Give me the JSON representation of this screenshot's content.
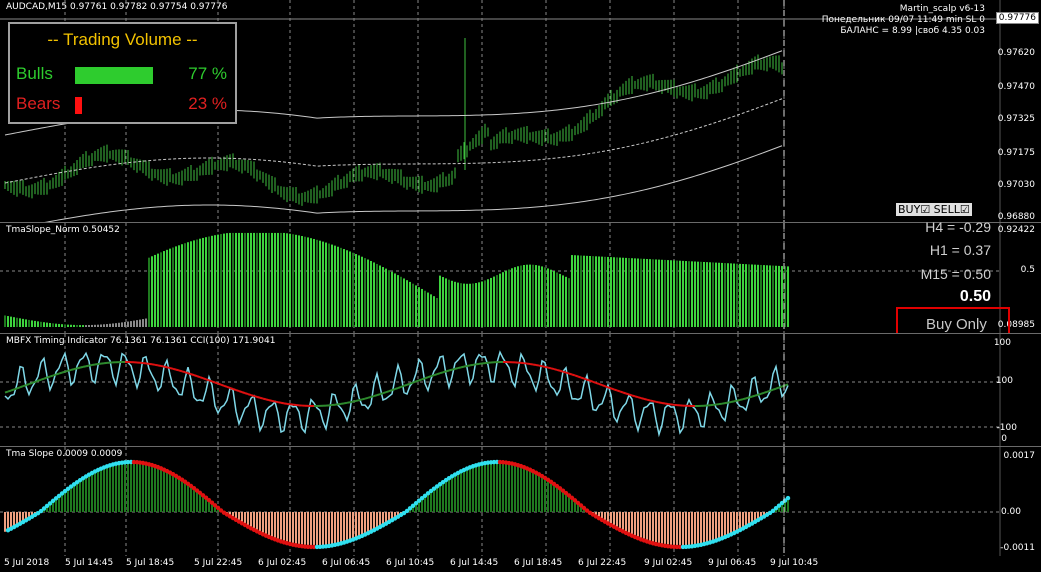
{
  "main_chart": {
    "title": "AUDCAD,M15  0.97761 0.97782 0.97754 0.97776",
    "current_price": "0.97776",
    "price_labels": [
      "0.97620",
      "0.97470",
      "0.97325",
      "0.97175",
      "0.97030",
      "0.96880"
    ],
    "info_line1": "Martin_scalp v6-13",
    "info_line2": "Понедельник  09/07 11:49 min SL 0",
    "info_line3": "БАЛАНС = 8.99 |своб 4.35 0.03",
    "buy_sell": "BUY☑ SELL☑",
    "colors": {
      "candle": "#3fbf3f",
      "band": "#c8c8c8"
    }
  },
  "volume_panel": {
    "title": "-- Trading Volume --",
    "bulls_label": "Bulls",
    "bulls_pct": "77 %",
    "bulls_fraction": 0.77,
    "bears_label": "Bears",
    "bears_pct": "23 %",
    "bears_fraction": 0.23,
    "colors": {
      "bulls": "#2ecc2e",
      "bears": "#ff1010",
      "title": "#f2c200"
    }
  },
  "tma_norm": {
    "title": "TmaSlope_Norm 0.50452",
    "price_labels": [
      "0.92422",
      "0.5",
      "0.08985"
    ],
    "h4": "H4 = -0.29",
    "h1": "H1 = 0.37",
    "m15": "M15 = 0.50",
    "big_value": "0.50",
    "signal": "Buy Only"
  },
  "mbfx": {
    "title": "MBFX Timing Indicator 76.1361 76.1361  CCI(100) 171.9041",
    "price_labels": [
      "100",
      "100",
      "-100",
      "0"
    ]
  },
  "tma_slope": {
    "title": "Tma Slope 0.0009 0.0009",
    "price_labels": [
      "0.0017",
      "0.00",
      "-0.0011"
    ]
  },
  "x_axis": {
    "labels": [
      "5 Jul 2018",
      "5 Jul 14:45",
      "5 Jul 18:45",
      "5 Jul 22:45",
      "6 Jul 02:45",
      "6 Jul 06:45",
      "6 Jul 10:45",
      "6 Jul 14:45",
      "6 Jul 18:45",
      "6 Jul 22:45",
      "9 Jul 02:45",
      "9 Jul 06:45",
      "9 Jul 10:45"
    ]
  }
}
